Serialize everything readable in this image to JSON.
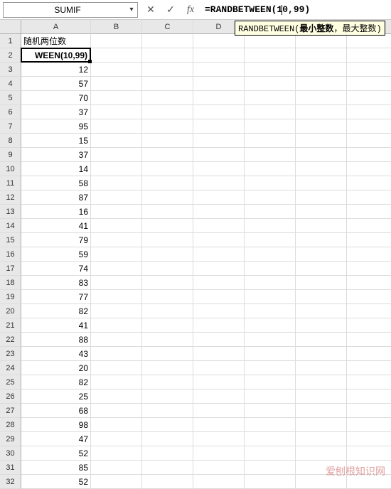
{
  "formulaBar": {
    "nameBox": "SUMIF",
    "formula_pre": "=RANDBETWEEN(1",
    "formula_mid": "0",
    "formula_post": ",99)"
  },
  "tooltip": {
    "fn": "RANDBETWEEN",
    "open": "(",
    "arg1": "最小整数",
    "sep": "，",
    "arg2": "最大整数",
    "close": ")"
  },
  "columns": [
    "A",
    "B",
    "C",
    "D",
    "E",
    "F",
    "G"
  ],
  "rowCount": 32,
  "header_A1": "随机两位数",
  "activeCell": {
    "display": "WEEN(10,99)"
  },
  "columnA": {
    "3": "12",
    "4": "57",
    "5": "70",
    "6": "37",
    "7": "95",
    "8": "15",
    "9": "37",
    "10": "14",
    "11": "58",
    "12": "87",
    "13": "16",
    "14": "41",
    "15": "79",
    "16": "59",
    "17": "74",
    "18": "83",
    "19": "77",
    "20": "82",
    "21": "41",
    "22": "88",
    "23": "43",
    "24": "20",
    "25": "82",
    "26": "25",
    "27": "68",
    "28": "98",
    "29": "47",
    "30": "52",
    "31": "85",
    "32": "52"
  },
  "watermark": "爱刨根知识网"
}
